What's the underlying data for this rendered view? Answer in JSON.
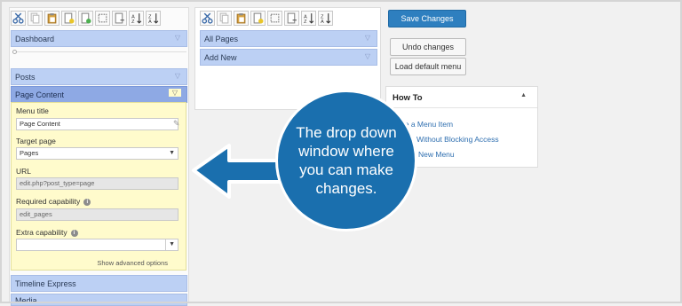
{
  "left_panel": {
    "toolbar_icons": [
      "cut-icon",
      "copy-icon",
      "paste-icon",
      "new-menu-icon",
      "new-separator-icon",
      "select-icon",
      "hide-icon",
      "sort-asc-icon",
      "sort-desc-icon"
    ],
    "menus": {
      "dashboard": "Dashboard",
      "posts": "Posts",
      "page_content": "Page Content",
      "timeline_express": "Timeline Express",
      "media": "Media"
    },
    "editor": {
      "menu_title_label": "Menu title",
      "menu_title_value": "Page Content",
      "target_page_label": "Target page",
      "target_page_value": "Pages",
      "url_label": "URL",
      "url_value": "edit.php?post_type=page",
      "required_capability_label": "Required capability",
      "required_capability_value": "edit_pages",
      "extra_capability_label": "Extra capability",
      "extra_capability_value": "",
      "advanced_link": "Show advanced options"
    }
  },
  "middle_panel": {
    "items": {
      "all_pages": "All Pages",
      "add_new": "Add New"
    }
  },
  "actions": {
    "save": "Save Changes",
    "undo": "Undo changes",
    "load_default": "Load default menu"
  },
  "howto": {
    "title": "How To",
    "links": {
      "l1": "de a Menu Item",
      "l2": "Without Blocking Access",
      "l3": "New Menu"
    }
  },
  "callout": {
    "text": "The drop down window where you can make changes."
  },
  "colors": {
    "accent": "#2e7fbf",
    "menu_item": "#bcd0f4",
    "selected": "#8ea9e4",
    "editor_bg": "#fffbcc",
    "callout": "#1a6fae"
  }
}
